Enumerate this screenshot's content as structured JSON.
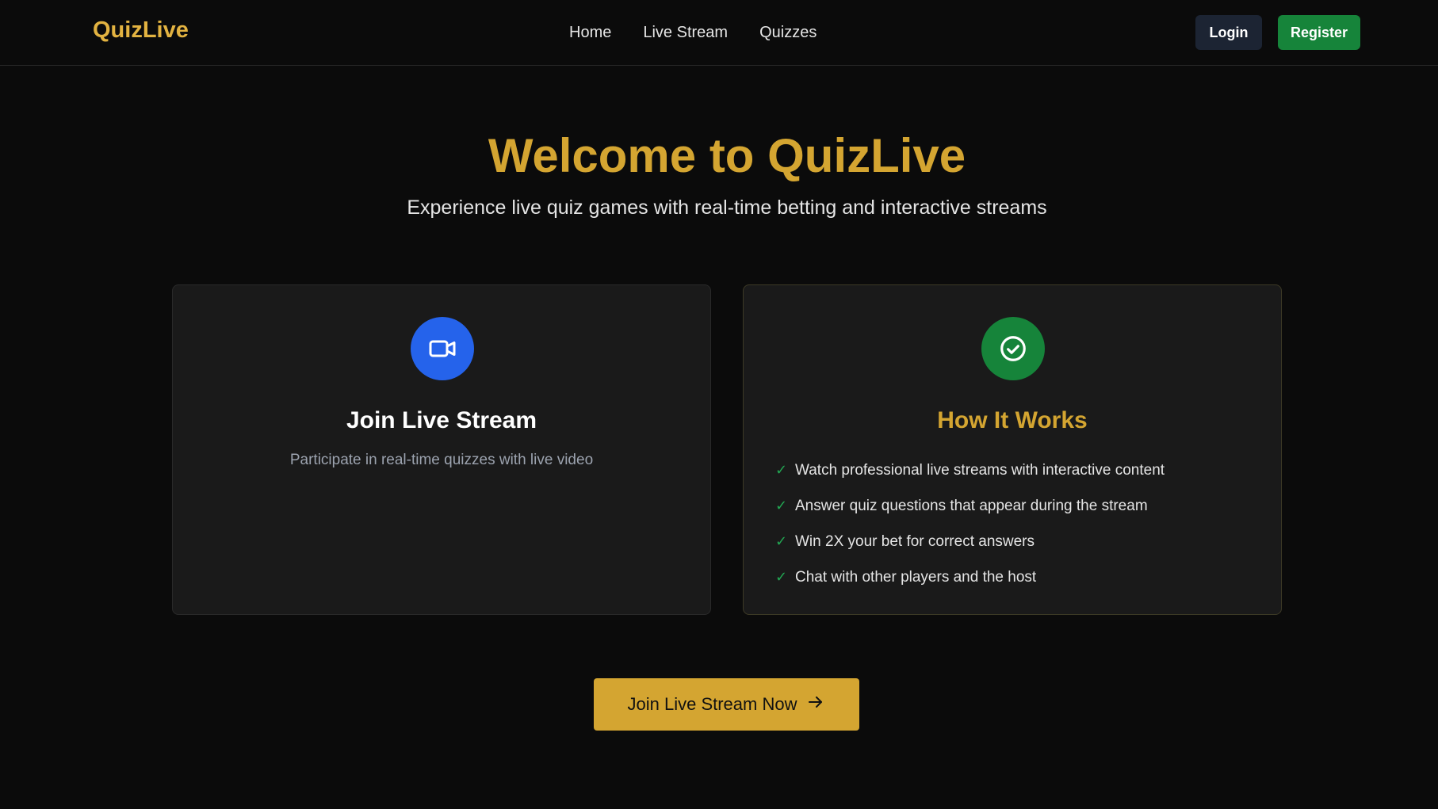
{
  "header": {
    "brand": "QuizLive",
    "nav": [
      "Home",
      "Live Stream",
      "Quizzes"
    ],
    "login_label": "Login",
    "register_label": "Register"
  },
  "hero": {
    "title": "Welcome to QuizLive",
    "subtitle": "Experience live quiz games with real-time betting and interactive streams"
  },
  "cards": {
    "join": {
      "icon": "video-camera-icon",
      "title": "Join Live Stream",
      "description": "Participate in real-time quizzes with live video"
    },
    "how_it_works": {
      "icon": "check-circle-icon",
      "title": "How It Works",
      "check_glyph": "✓",
      "items": [
        "Watch professional live streams with interactive content",
        "Answer quiz questions that appear during the stream",
        "Win 2X your bet for correct answers",
        "Chat with other players and the host"
      ]
    }
  },
  "cta": {
    "label": "Join Live Stream Now",
    "icon": "arrow-right-icon"
  },
  "colors": {
    "background": "#0b0b0b",
    "accent_gold": "#d4a531",
    "brand_gold": "#e3b341",
    "register_green": "#16843a",
    "join_blue": "#2563eb",
    "card_bg": "#1a1a1a"
  }
}
